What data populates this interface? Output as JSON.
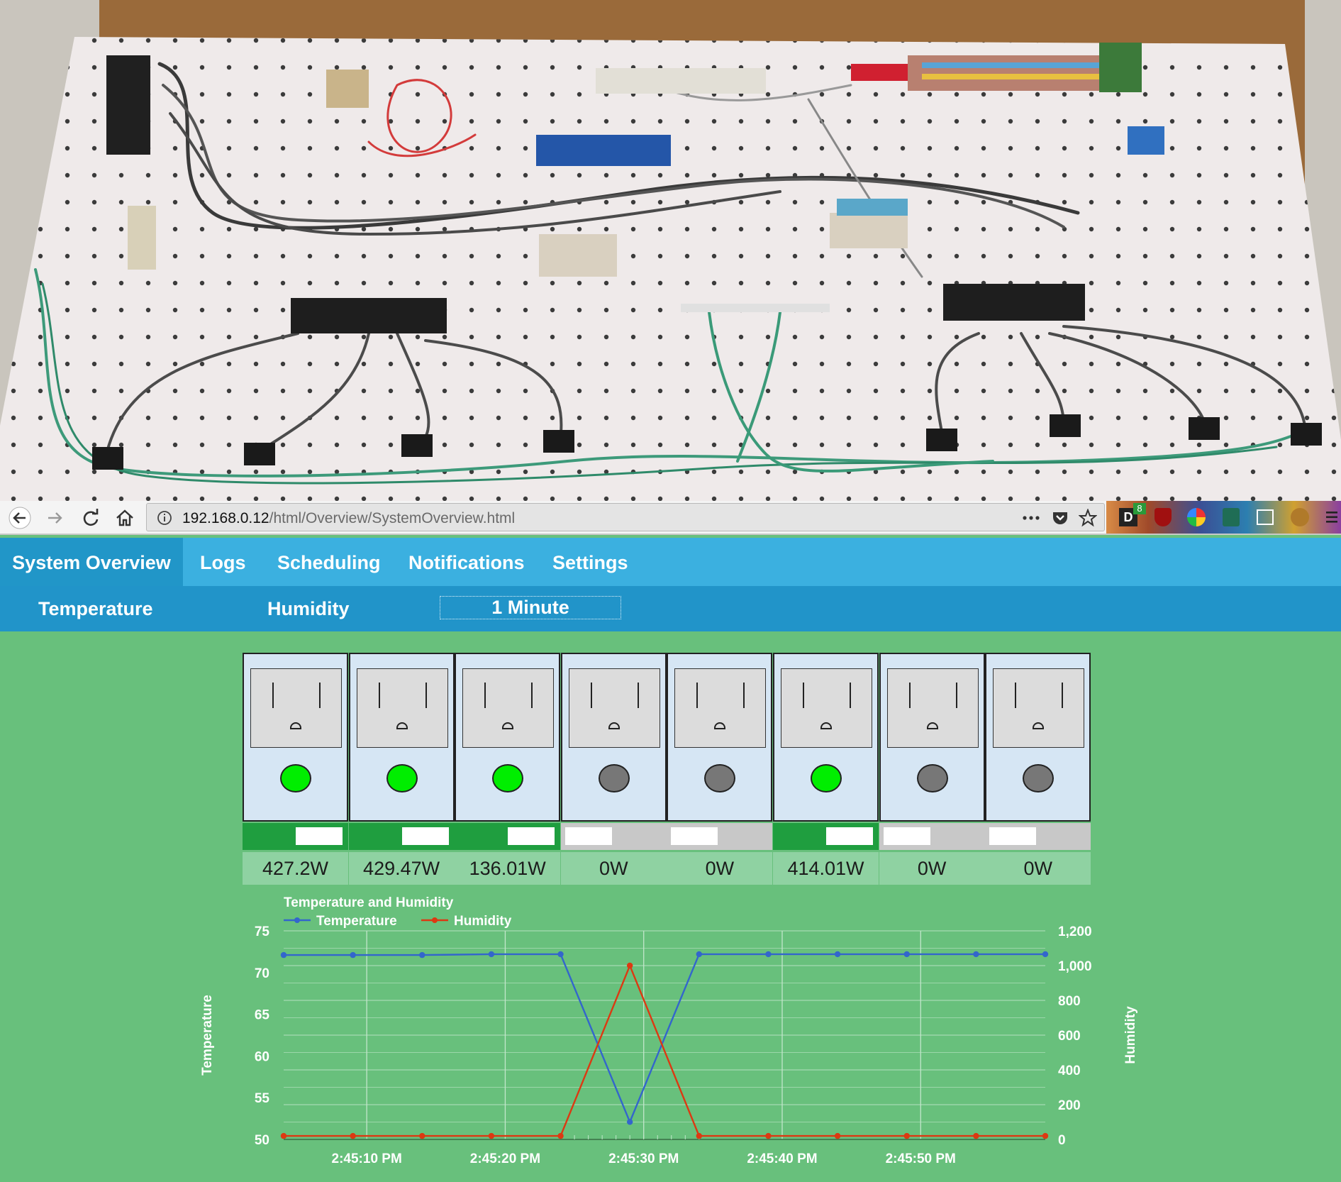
{
  "browser": {
    "url_host": "192.168.0.12",
    "url_path": "/html/Overview/SystemOverview.html",
    "page_actions_icon": "ellipsis-icon",
    "extension_badge_count": "8"
  },
  "nav": {
    "items": [
      {
        "label": "System Overview",
        "active": true
      },
      {
        "label": "Logs",
        "active": false
      },
      {
        "label": "Scheduling",
        "active": false
      },
      {
        "label": "Notifications",
        "active": false
      },
      {
        "label": "Settings",
        "active": false
      }
    ]
  },
  "subnav": {
    "temperature_label": "Temperature",
    "humidity_label": "Humidity",
    "interval_label": "1 Minute"
  },
  "colors": {
    "led_on": "#00ee00",
    "led_off": "#777777",
    "toggle_on": "#1f9e3f",
    "toggle_off": "#c8c8c8",
    "temperature_series": "#3366cc",
    "humidity_series": "#dc3912",
    "page_background": "#68c07c"
  },
  "outlets": [
    {
      "on": true,
      "power": "427.2W"
    },
    {
      "on": true,
      "power": "429.47W"
    },
    {
      "on": true,
      "power": "136.01W"
    },
    {
      "on": false,
      "power": "0W"
    },
    {
      "on": false,
      "power": "0W"
    },
    {
      "on": true,
      "power": "414.01W"
    },
    {
      "on": false,
      "power": "0W"
    },
    {
      "on": false,
      "power": "0W"
    }
  ],
  "chart_data": {
    "type": "line",
    "title": "Temperature and Humidity",
    "xlabel": "",
    "ylabel": "Temperature",
    "y2label": "Humidity",
    "ylim": [
      50,
      75
    ],
    "y2lim": [
      0,
      1200
    ],
    "yticks": [
      "75",
      "70",
      "65",
      "60",
      "55",
      "50"
    ],
    "y2ticks": [
      "1,200",
      "1,000",
      "800",
      "600",
      "400",
      "200",
      "0"
    ],
    "xticks": [
      "2:45:10 PM",
      "2:45:20 PM",
      "2:45:30 PM",
      "2:45:40 PM",
      "2:45:50 PM"
    ],
    "legend_position": "top-left",
    "grid": true,
    "series": [
      {
        "name": "Temperature",
        "axis": "left",
        "values": [
          72.1,
          72.1,
          72.1,
          72.2,
          72.2,
          52.1,
          72.2,
          72.2,
          72.2,
          72.2,
          72.2,
          72.2
        ]
      },
      {
        "name": "Humidity",
        "axis": "right",
        "values": [
          20,
          20,
          20,
          20,
          20,
          1000,
          20,
          20,
          20,
          20,
          20,
          20
        ]
      }
    ]
  }
}
